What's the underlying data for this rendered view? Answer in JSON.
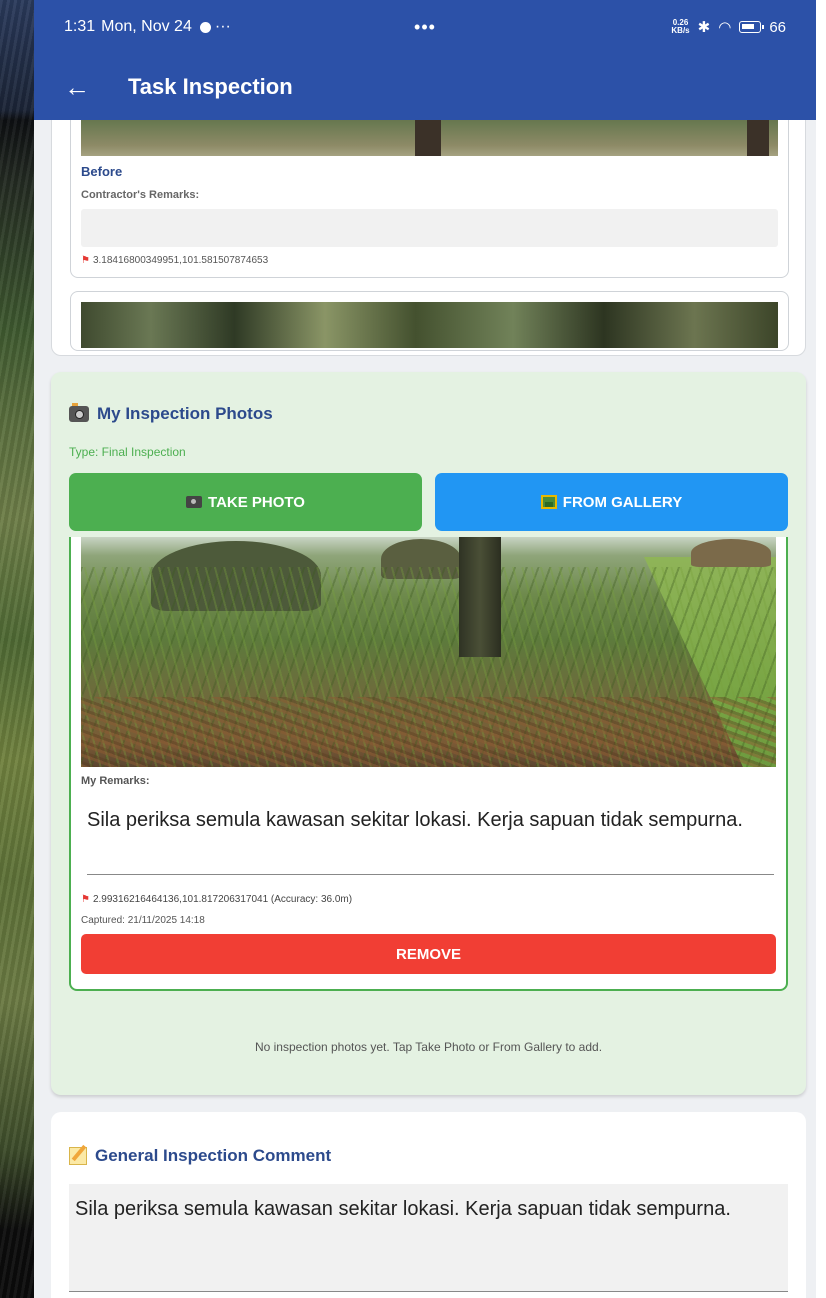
{
  "statusbar": {
    "time": "1:31",
    "date": "Mon, Nov 24",
    "notif_more": "···",
    "center_dots": "•••",
    "net_speed_value": "0.26",
    "net_speed_unit": "KB/s",
    "battery": "66"
  },
  "appbar": {
    "back_icon": "←",
    "title": "Task Inspection"
  },
  "contractor_photo": {
    "stage_label": "Before",
    "remarks_label": "Contractor's Remarks:",
    "remarks_value": "",
    "coordinates": "3.18416800349951,101.581507874653"
  },
  "inspection": {
    "section_title": "My Inspection Photos",
    "type_text": "Type: Final Inspection",
    "take_photo_label": "TAKE PHOTO",
    "from_gallery_label": "FROM GALLERY",
    "item": {
      "remarks_label": "My Remarks:",
      "remarks_value": "Sila periksa semula kawasan sekitar lokasi. Kerja sapuan tidak sempurna.",
      "coordinates": "2.99316216464136,101.817206317041 (Accuracy: 36.0m)",
      "captured": "Captured: 21/11/2025 14:18",
      "remove_label": "REMOVE"
    },
    "empty_text": "No inspection photos yet. Tap Take Photo or From Gallery to add."
  },
  "general_comment": {
    "section_title": "General Inspection Comment",
    "value": "Sila periksa semula kawasan sekitar lokasi. Kerja sapuan tidak sempurna."
  },
  "colors": {
    "header": "#2c51a8",
    "take_photo": "#4caf50",
    "from_gallery": "#2196f3",
    "remove": "#f13e34",
    "section_bg": "#e4f2e2",
    "title_text": "#2c4a8c"
  },
  "icons": {
    "back": "arrow-left-icon",
    "location": "map-pin-icon",
    "camera": "camera-icon",
    "gallery": "picture-icon",
    "comment": "memo-icon"
  }
}
